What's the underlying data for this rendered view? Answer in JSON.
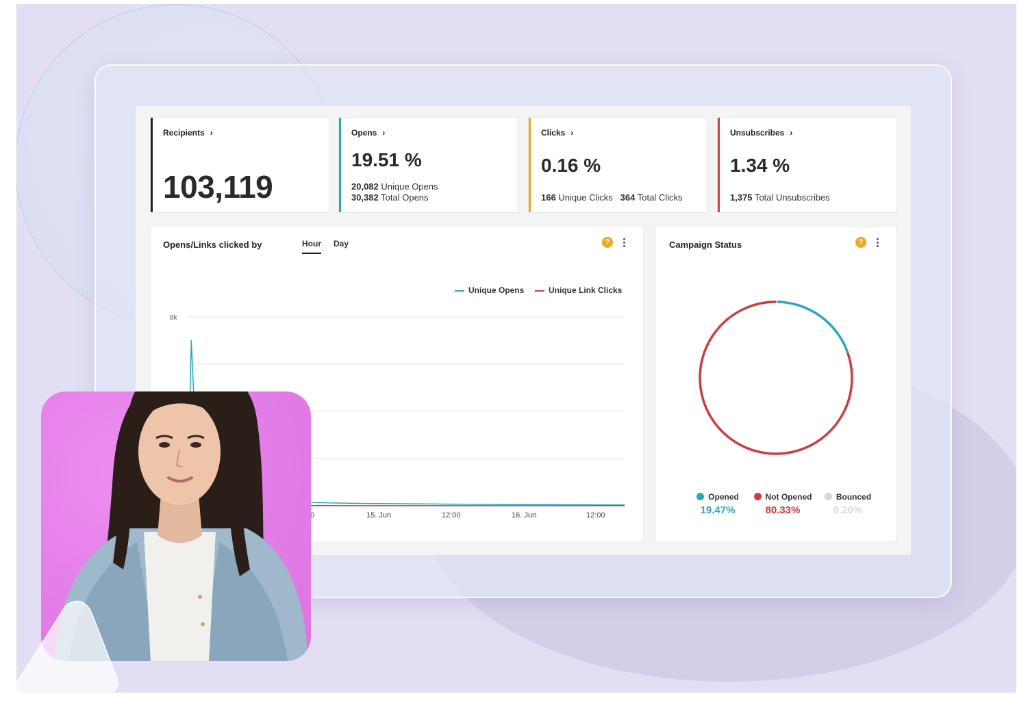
{
  "cards": {
    "recipients": {
      "label": "Recipients",
      "value": "103,119"
    },
    "opens": {
      "label": "Opens",
      "value": "19.51 %",
      "unique_num": "20,082",
      "unique_text": "Unique Opens",
      "total_num": "30,382",
      "total_text": "Total Opens"
    },
    "clicks": {
      "label": "Clicks",
      "value": "0.16 %",
      "unique_num": "166",
      "unique_text": "Unique Clicks",
      "total_num": "364",
      "total_text": "Total Clicks"
    },
    "unsubscribes": {
      "label": "Unsubscribes",
      "value": "1.34 %",
      "total_num": "1,375",
      "total_text": "Total Unsubscribes"
    }
  },
  "opens_chart": {
    "title": "Opens/Links clicked by",
    "tabs": {
      "hour": "Hour",
      "day": "Day"
    },
    "help": "?"
  },
  "chart_data": [
    {
      "type": "line",
      "title": "Opens/Links clicked by",
      "ylim": [
        0,
        8000
      ],
      "yticks": [
        "8k"
      ],
      "x_tick_labels": [
        "0",
        "15. Jun",
        "12:00",
        "16. Jun",
        "12:00"
      ],
      "series": [
        {
          "name": "Unique Opens",
          "color": "#2aa7be",
          "x": [
            0,
            0.5,
            1,
            2,
            4,
            8,
            12,
            16,
            20,
            24,
            28,
            32,
            36,
            40,
            44,
            48,
            52,
            56,
            60
          ],
          "values": [
            0,
            7000,
            3600,
            800,
            400,
            250,
            200,
            150,
            120,
            100,
            90,
            80,
            70,
            60,
            55,
            50,
            45,
            40,
            35
          ]
        },
        {
          "name": "Unique Link Clicks",
          "color": "#d03b3f",
          "x": [
            0,
            10,
            20,
            30,
            40,
            50,
            60
          ],
          "values": [
            0,
            5,
            5,
            4,
            3,
            3,
            2
          ]
        }
      ]
    },
    {
      "type": "pie",
      "title": "Campaign Status",
      "categories": [
        "Opened",
        "Not Opened",
        "Bounced"
      ],
      "values": [
        19.47,
        80.33,
        0.2
      ],
      "colors": [
        "#2aa7be",
        "#d03b3f",
        "#d6d6d6"
      ]
    }
  ],
  "campaign_status": {
    "title": "Campaign Status",
    "help": "?",
    "legend": [
      {
        "name": "Opened",
        "value": "19.47%",
        "color": "#2aa7be"
      },
      {
        "name": "Not Opened",
        "value": "80.33%",
        "color": "#d03b3f"
      },
      {
        "name": "Bounced",
        "value": "0.20%",
        "color": "#d6d6d6"
      }
    ]
  },
  "icons": {
    "help": "help-icon",
    "more": "more-vert-icon",
    "chevron": "chevron-right-icon"
  }
}
